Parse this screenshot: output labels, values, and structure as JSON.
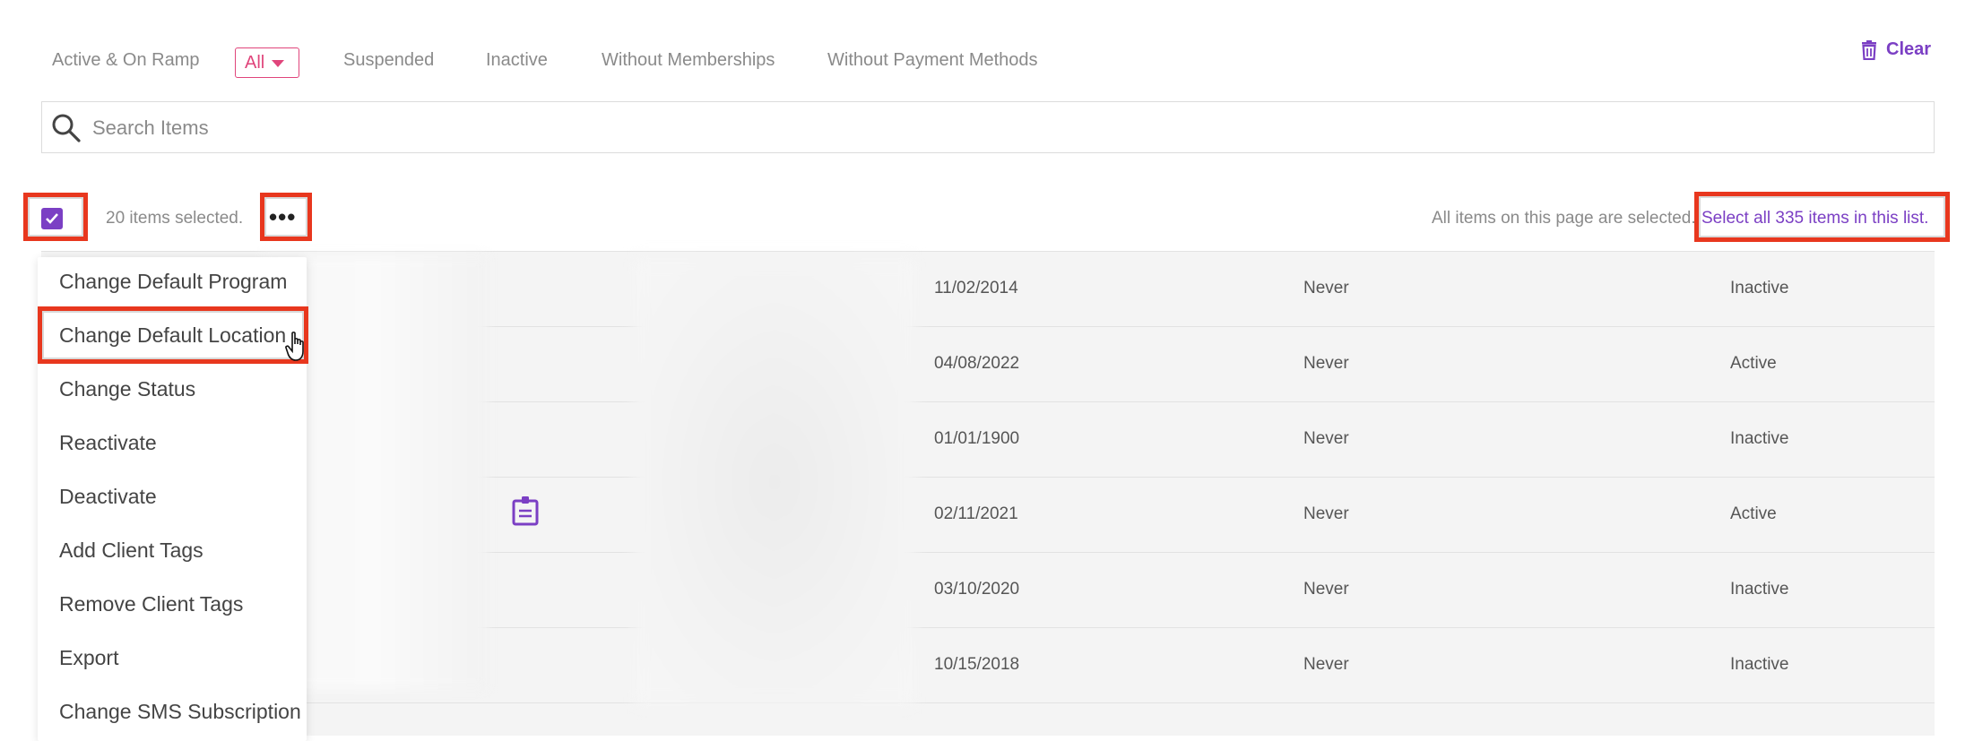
{
  "filters": {
    "tabs": [
      "Active & On Ramp",
      "All",
      "Suspended",
      "Inactive",
      "Without Memberships",
      "Without Payment Methods"
    ],
    "selected": "All",
    "clear_label": "Clear"
  },
  "search": {
    "placeholder": "Search Items",
    "value": ""
  },
  "selection": {
    "count_text": "20 items selected.",
    "more_label": "•••",
    "all_on_page_text": "All items on this page are selected.",
    "select_all_text": "Select all 335 items in this list."
  },
  "menu": {
    "items": [
      "Change Default Program",
      "Change Default Location",
      "Change Status",
      "Reactivate",
      "Deactivate",
      "Add Client Tags",
      "Remove Client Tags",
      "Export",
      "Change SMS Subscription"
    ],
    "hovered": "Change Default Location"
  },
  "table": {
    "rows": [
      {
        "date": "11/02/2014",
        "last": "Never",
        "status": "Inactive"
      },
      {
        "date": "04/08/2022",
        "last": "Never",
        "status": "Active"
      },
      {
        "date": "01/01/1900",
        "last": "Never",
        "status": "Inactive"
      },
      {
        "date": "02/11/2021",
        "last": "Never",
        "status": "Active"
      },
      {
        "date": "03/10/2020",
        "last": "Never",
        "status": "Inactive"
      },
      {
        "date": "10/15/2018",
        "last": "Never",
        "status": "Inactive"
      }
    ]
  },
  "colors": {
    "accent": "#7b3fc4",
    "pink": "#e0457b",
    "highlight": "#e8371e"
  },
  "icons": [
    "trash-icon",
    "search-icon",
    "check-icon",
    "badge-icon",
    "hand-cursor-icon",
    "caret-down-icon"
  ]
}
